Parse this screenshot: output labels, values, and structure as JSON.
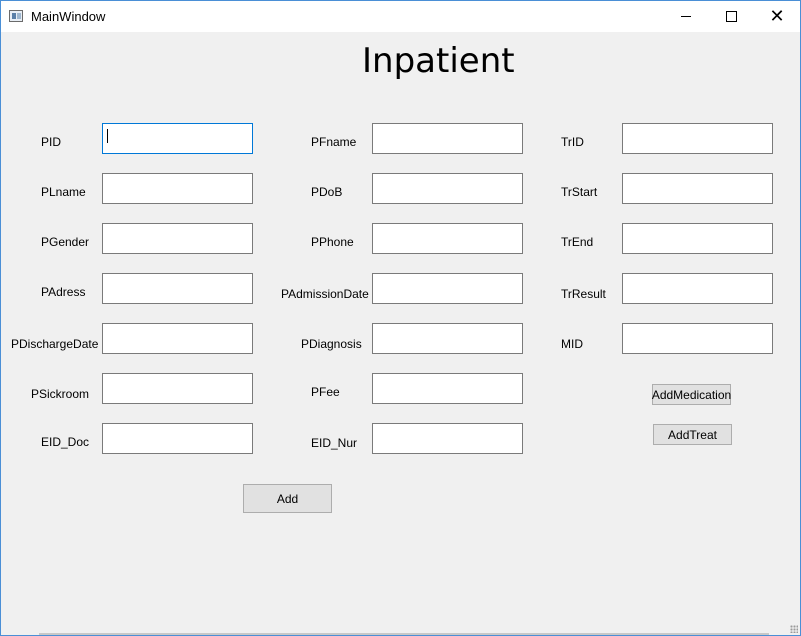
{
  "window": {
    "title": "MainWindow",
    "controls": {
      "minimize": "minimize",
      "maximize": "maximize",
      "close": "✕"
    }
  },
  "heading": "Inpatient",
  "fields": {
    "PID": {
      "label": "PID",
      "value": ""
    },
    "PLname": {
      "label": "PLname",
      "value": ""
    },
    "PGender": {
      "label": "PGender",
      "value": ""
    },
    "PAdress": {
      "label": "PAdress",
      "value": ""
    },
    "PDischargeDate": {
      "label": "PDischargeDate",
      "value": ""
    },
    "PSickroom": {
      "label": "PSickroom",
      "value": ""
    },
    "EID_Doc": {
      "label": "EID_Doc",
      "value": ""
    },
    "PFname": {
      "label": "PFname",
      "value": ""
    },
    "PDoB": {
      "label": "PDoB",
      "value": ""
    },
    "PPhone": {
      "label": "PPhone",
      "value": ""
    },
    "PAdmissionDate": {
      "label": "PAdmissionDate",
      "value": ""
    },
    "PDiagnosis": {
      "label": "PDiagnosis",
      "value": ""
    },
    "PFee": {
      "label": "PFee",
      "value": ""
    },
    "EID_Nur": {
      "label": "EID_Nur",
      "value": ""
    },
    "TrID": {
      "label": "TrID",
      "value": ""
    },
    "TrStart": {
      "label": "TrStart",
      "value": ""
    },
    "TrEnd": {
      "label": "TrEnd",
      "value": ""
    },
    "TrResult": {
      "label": "TrResult",
      "value": ""
    },
    "MID": {
      "label": "MID",
      "value": ""
    }
  },
  "buttons": {
    "add": "Add",
    "add_medication": "AddMedication",
    "add_treat": "AddTreat"
  }
}
